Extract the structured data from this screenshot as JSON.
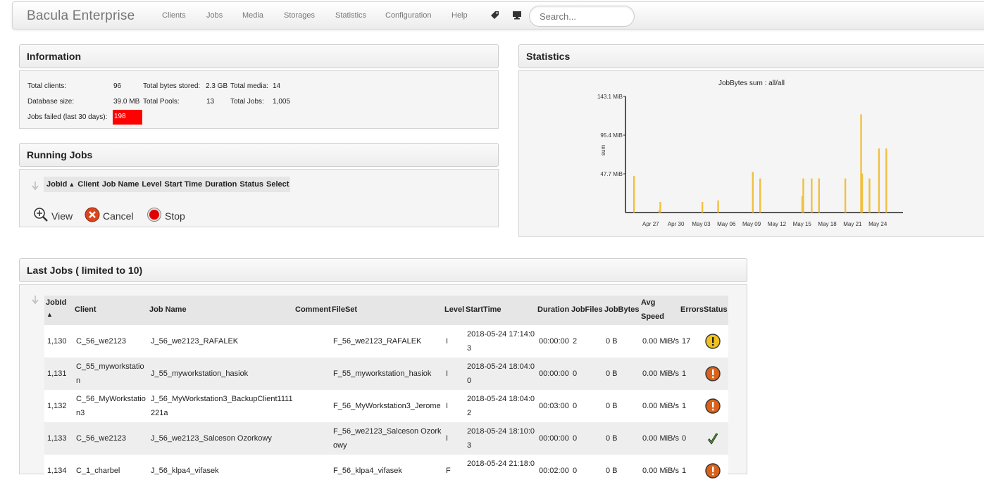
{
  "navbar": {
    "brand": "Bacula Enterprise",
    "items": [
      "Clients",
      "Jobs",
      "Media",
      "Storages",
      "Statistics",
      "Configuration",
      "Help"
    ],
    "icons": [
      "tag-icon",
      "monitor-icon"
    ],
    "search_placeholder": "Search..."
  },
  "information": {
    "title": "Information",
    "total_clients_label": "Total clients:",
    "total_clients": "96",
    "total_bytes_label": "Total bytes stored:",
    "total_bytes": "2.3 GB",
    "total_media_label": "Total media:",
    "total_media": "14",
    "db_size_label": "Database size:",
    "db_size": "39.0 MB",
    "total_pools_label": "Total Pools:",
    "total_pools": "13",
    "total_jobs_label": "Total Jobs:",
    "total_jobs": "1,005",
    "failed_label": "Jobs failed (last 30 days):",
    "failed": "198",
    "failed_color": "#ff0000"
  },
  "running_jobs": {
    "title": "Running Jobs",
    "columns": [
      "JobId",
      "Client",
      "Job Name",
      "Level",
      "Start Time",
      "Duration",
      "Status",
      "Select"
    ],
    "actions": {
      "view": "View",
      "cancel": "Cancel",
      "stop": "Stop"
    }
  },
  "statistics": {
    "title": "Statistics"
  },
  "chart_data": {
    "type": "bar",
    "title": "JobBytes sum : all/all",
    "ylabel": "sum",
    "y_ticks": [
      "47.7 MiB",
      "95.4 MiB",
      "143.1 MiB"
    ],
    "ylim": [
      0,
      143.1
    ],
    "x_ticks": [
      "Apr 27",
      "Apr 30",
      "May 03",
      "May 06",
      "May 09",
      "May 12",
      "May 15",
      "May 18",
      "May 21",
      "May 24"
    ],
    "color": "#f0c040",
    "points": [
      {
        "x": "Apr 25",
        "y": 45
      },
      {
        "x": "Apr 28",
        "y": 13
      },
      {
        "x": "Apr 28",
        "y": 3
      },
      {
        "x": "May 03",
        "y": 13
      },
      {
        "x": "May 05",
        "y": 15
      },
      {
        "x": "May 09",
        "y": 50
      },
      {
        "x": "May 10",
        "y": 42
      },
      {
        "x": "May 15",
        "y": 42
      },
      {
        "x": "May 15",
        "y": 20
      },
      {
        "x": "May 16",
        "y": 42
      },
      {
        "x": "May 17",
        "y": 42
      },
      {
        "x": "May 20",
        "y": 42
      },
      {
        "x": "May 22",
        "y": 121
      },
      {
        "x": "May 22",
        "y": 48
      },
      {
        "x": "May 23",
        "y": 42
      },
      {
        "x": "May 24",
        "y": 79
      },
      {
        "x": "May 25",
        "y": 79
      }
    ]
  },
  "last_jobs": {
    "title": "Last Jobs ( limited to 10)",
    "columns": {
      "jobid": "JobId",
      "client": "Client",
      "jobname": "Job Name",
      "comment": "Comment",
      "fileset": "FileSet",
      "level": "Level",
      "starttime": "StartTime",
      "duration": "Duration",
      "jobfiles": "JobFiles",
      "jobbytes": "JobBytes",
      "avgspeed1": "Avg",
      "avgspeed2": "Speed",
      "errors": "Errors",
      "status": "Status"
    },
    "rows": [
      {
        "jobid": "1,130",
        "client": "C_56_we2123",
        "client2": "",
        "jobname": "J_56_we2123_RAFALEK",
        "jobname2": "",
        "fileset": "F_56_we2123_RAFALEK",
        "fileset2": "",
        "level": "I",
        "start1": "2018-05-24 17:14:0",
        "start2": "3",
        "duration": "00:00:00",
        "files": "2",
        "bytes": "0 B",
        "speed": "0.00 MiB/s",
        "errors": "17",
        "status": "warning"
      },
      {
        "jobid": "1,131",
        "client": "C_55_myworkstatio",
        "client2": "n",
        "jobname": "J_55_myworkstation_hasiok",
        "jobname2": "",
        "fileset": "F_55_myworkstation_hasiok",
        "fileset2": "",
        "level": "I",
        "start1": "2018-05-24 18:04:0",
        "start2": "0",
        "duration": "00:00:00",
        "files": "0",
        "bytes": "0 B",
        "speed": "0.00 MiB/s",
        "errors": "1",
        "status": "error"
      },
      {
        "jobid": "1,132",
        "client": "C_56_MyWorkstatio",
        "client2": "n3",
        "jobname": "J_56_MyWorkstation3_BackupClient1111",
        "jobname2": "221a",
        "fileset": "F_56_MyWorkstation3_Jerome",
        "fileset2": "",
        "level": "I",
        "start1": "2018-05-24 18:04:0",
        "start2": "2",
        "duration": "00:03:00",
        "files": "0",
        "bytes": "0 B",
        "speed": "0.00 MiB/s",
        "errors": "1",
        "status": "error"
      },
      {
        "jobid": "1,133",
        "client": "C_56_we2123",
        "client2": "",
        "jobname": "J_56_we2123_Salceson Ozorkowy",
        "jobname2": "",
        "fileset": "F_56_we2123_Salceson  Ozork",
        "fileset2": "owy",
        "level": "I",
        "start1": "2018-05-24 18:10:0",
        "start2": "3",
        "duration": "00:00:00",
        "files": "0",
        "bytes": "0 B",
        "speed": "0.00 MiB/s",
        "errors": "0",
        "status": "ok"
      },
      {
        "jobid": "1,134",
        "client": "C_1_charbel",
        "client2": "",
        "jobname": "J_56_klpa4_vifasek",
        "jobname2": "",
        "fileset": "F_56_klpa4_vifasek",
        "fileset2": "",
        "level": "F",
        "start1": "2018-05-24 21:18:0",
        "start2": "",
        "duration": "00:02:00",
        "files": "0",
        "bytes": "0 B",
        "speed": "0.00 MiB/s",
        "errors": "1",
        "status": "error"
      }
    ]
  }
}
